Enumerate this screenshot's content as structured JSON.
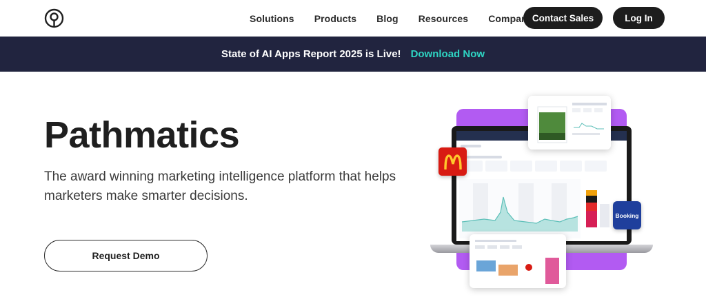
{
  "nav": {
    "logo_icon": "pathmatics-logo-icon",
    "links": [
      "Solutions",
      "Products",
      "Blog",
      "Resources",
      "Company"
    ],
    "contact_label": "Contact Sales",
    "login_label": "Log In"
  },
  "banner": {
    "text": "State of AI Apps Report 2025 is Live!",
    "link_label": "Download Now",
    "link_color": "#2ed5c3",
    "background": "#21243f"
  },
  "hero": {
    "title": "Pathmatics",
    "subtitle": "The award winning marketing intelligence platform that helps marketers make smarter decisions.",
    "cta_label": "Request Demo"
  },
  "illustration": {
    "accent": "#b25bf2",
    "badges": {
      "mcdonalds_icon": "mcdonalds-logo-icon",
      "booking_label": "Booking"
    }
  }
}
